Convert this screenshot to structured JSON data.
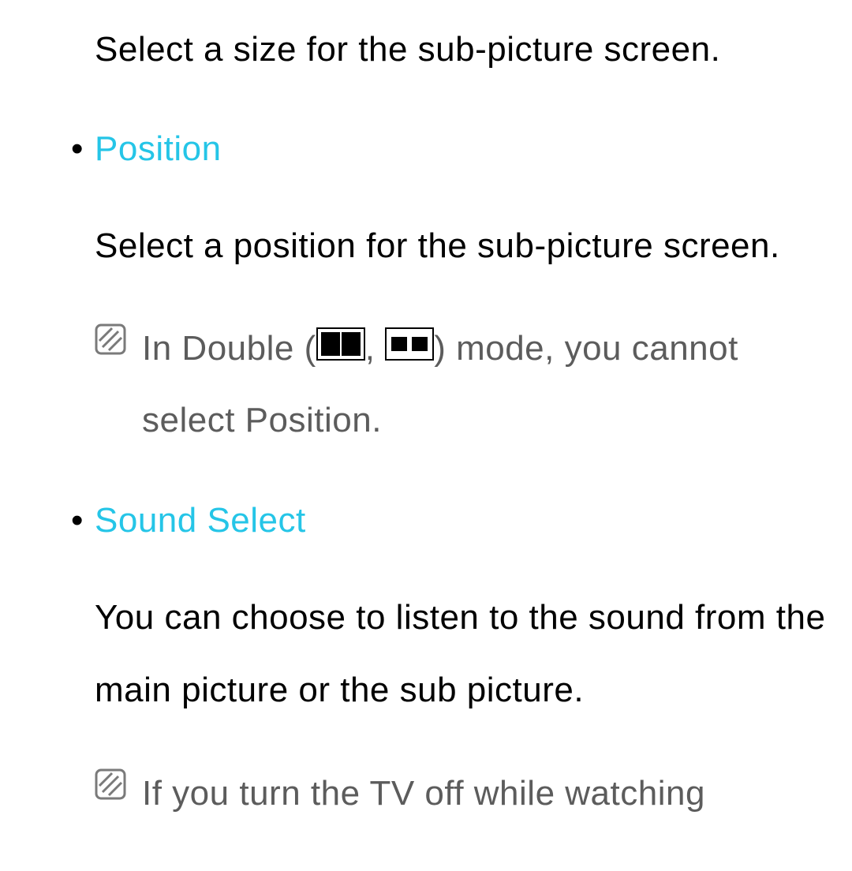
{
  "sections": [
    {
      "intro": "Select a size for the sub-picture screen."
    },
    {
      "heading": "Position",
      "description": "Select a position for the sub-picture screen.",
      "note_prefix": "In Double (",
      "note_mid": ", ",
      "note_suffix": ") mode, you cannot select Position."
    },
    {
      "heading": "Sound Select",
      "description": "You can choose to listen to the sound from the main picture or the sub picture.",
      "note": "If you turn the TV off while watching"
    }
  ]
}
